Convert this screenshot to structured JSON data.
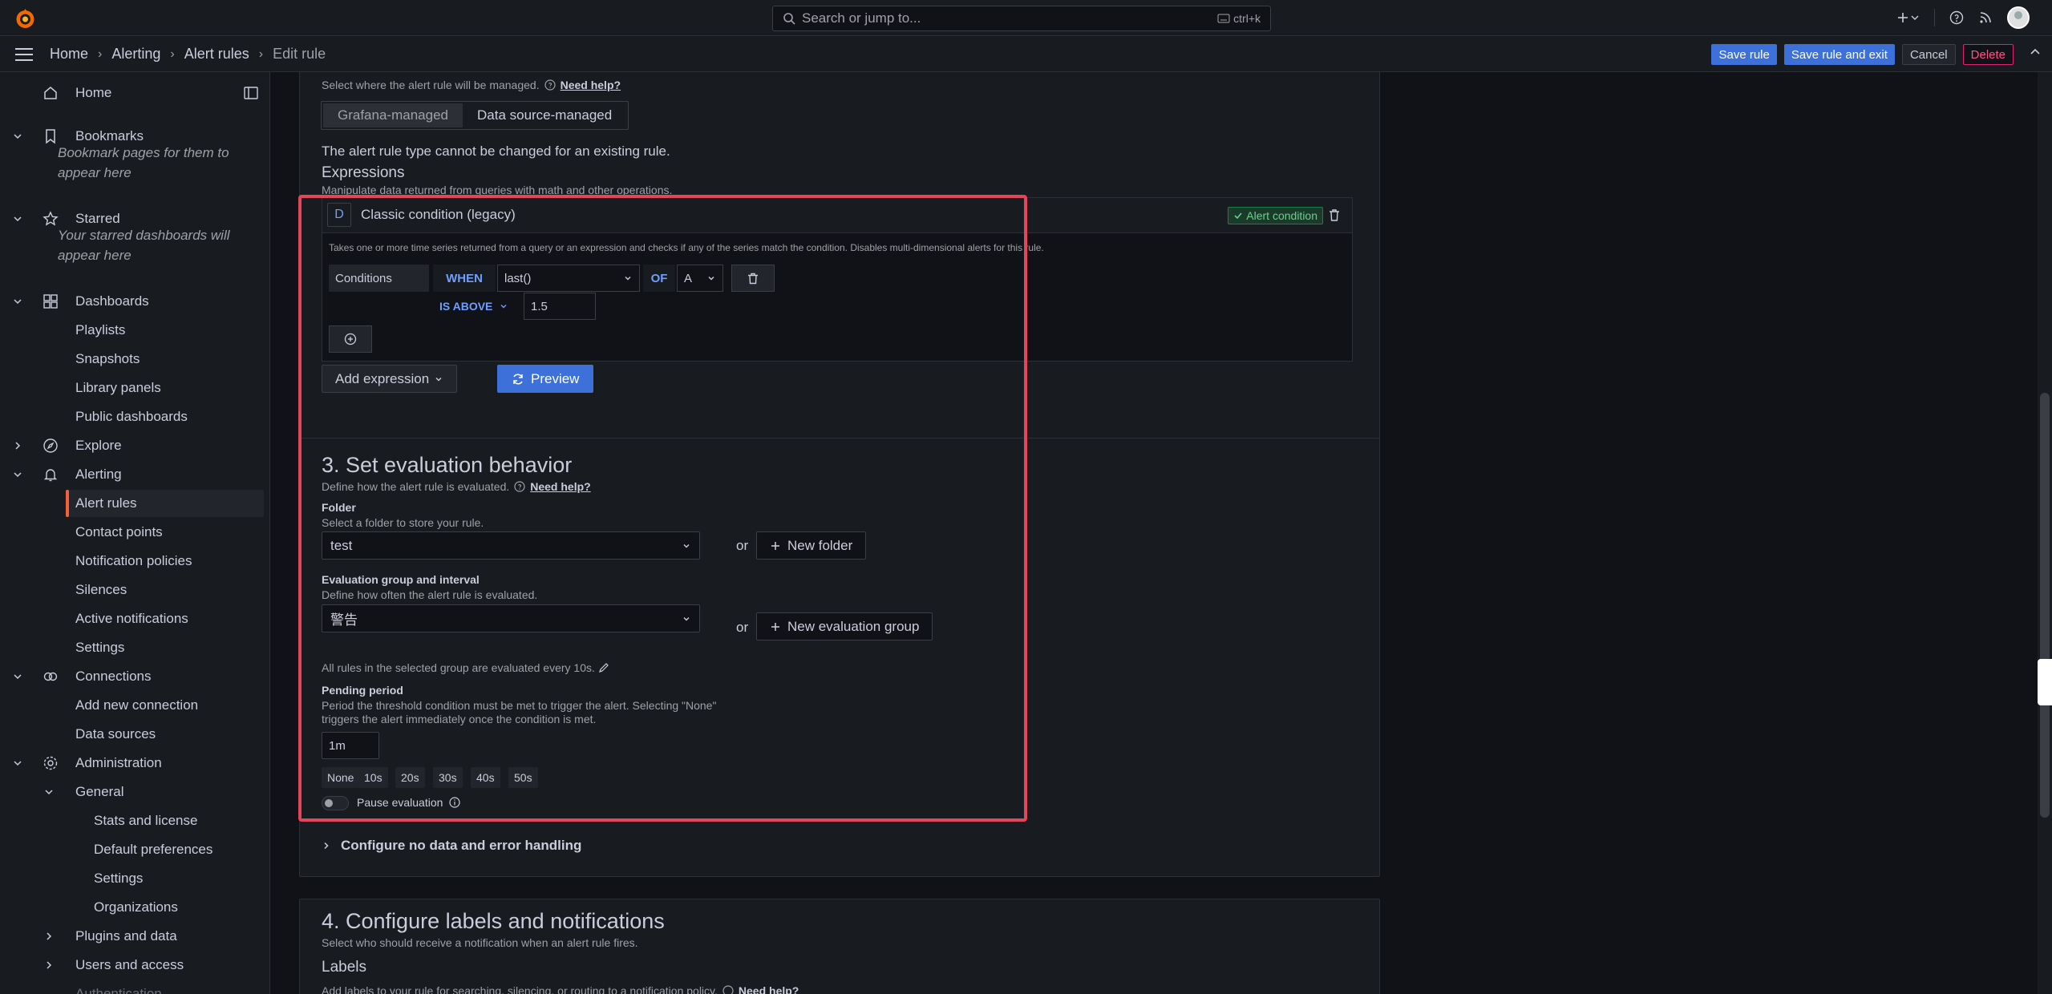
{
  "topbar": {
    "search_placeholder": "Search or jump to...",
    "search_shortcut": "ctrl+k"
  },
  "breadcrumb": [
    "Home",
    "Alerting",
    "Alert rules",
    "Edit rule"
  ],
  "actions": {
    "save": "Save rule",
    "save_exit": "Save rule and exit",
    "cancel": "Cancel",
    "delete": "Delete"
  },
  "sidebar": {
    "home": "Home",
    "bookmarks": "Bookmarks",
    "bookmarks_note": "Bookmark pages for them to appear here",
    "starred": "Starred",
    "starred_note": "Your starred dashboards will appear here",
    "dashboards": "Dashboards",
    "playlists": "Playlists",
    "snapshots": "Snapshots",
    "library_panels": "Library panels",
    "public_dashboards": "Public dashboards",
    "explore": "Explore",
    "alerting": "Alerting",
    "alert_rules": "Alert rules",
    "contact_points": "Contact points",
    "notification_policies": "Notification policies",
    "silences": "Silences",
    "active_notifications": "Active notifications",
    "alerting_settings": "Settings",
    "connections": "Connections",
    "add_new_connection": "Add new connection",
    "data_sources": "Data sources",
    "administration": "Administration",
    "general": "General",
    "stats_license": "Stats and license",
    "default_preferences": "Default preferences",
    "general_settings": "Settings",
    "organizations": "Organizations",
    "plugins_data": "Plugins and data",
    "users_access": "Users and access",
    "authentication": "Authentication"
  },
  "rule_type": {
    "help_text": "Select where the alert rule will be managed.",
    "need_help": "Need help?",
    "options": [
      "Grafana-managed",
      "Data source-managed"
    ],
    "note": "The alert rule type cannot be changed for an existing rule."
  },
  "expressions": {
    "title": "Expressions",
    "desc": "Manipulate data returned from queries with math and other operations.",
    "query_id": "D",
    "query_title": "Classic condition (legacy)",
    "alert_condition": "Alert condition",
    "query_desc": "Takes one or more time series returned from a query or an expression and checks if any of the series match the condition. Disables multi-dimensional alerts for this rule.",
    "conditions_label": "Conditions",
    "when": "WHEN",
    "reducer": "last()",
    "of": "OF",
    "ref": "A",
    "evaluator": "IS ABOVE",
    "threshold": "1.5",
    "add_expression": "Add expression",
    "preview": "Preview"
  },
  "evaluation": {
    "title": "3. Set evaluation behavior",
    "desc": "Define how the alert rule is evaluated.",
    "need_help": "Need help?",
    "folder_label": "Folder",
    "folder_desc": "Select a folder to store your rule.",
    "folder_value": "test",
    "or": "or",
    "new_folder": "New folder",
    "group_label": "Evaluation group and interval",
    "group_desc": "Define how often the alert rule is evaluated.",
    "group_value": "警告",
    "new_group": "New evaluation group",
    "interval_note": "All rules in the selected group are evaluated every 10s.",
    "pending_label": "Pending period",
    "pending_desc_1": "Period the threshold condition must be met to trigger the alert. Selecting \"None\"",
    "pending_desc_2": "triggers the alert immediately once the condition is met.",
    "pending_value": "1m",
    "pending_options": [
      "None",
      "10s",
      "20s",
      "30s",
      "40s",
      "50s"
    ],
    "pause": "Pause evaluation",
    "configure_no_data": "Configure no data and error handling"
  },
  "labels_section": {
    "title": "4. Configure labels and notifications",
    "desc": "Select who should receive a notification when an alert rule fires.",
    "labels": "Labels",
    "labels_desc": "Add labels to your rule for searching, silencing, or routing to a notification policy.",
    "need_help": "Need help?"
  }
}
